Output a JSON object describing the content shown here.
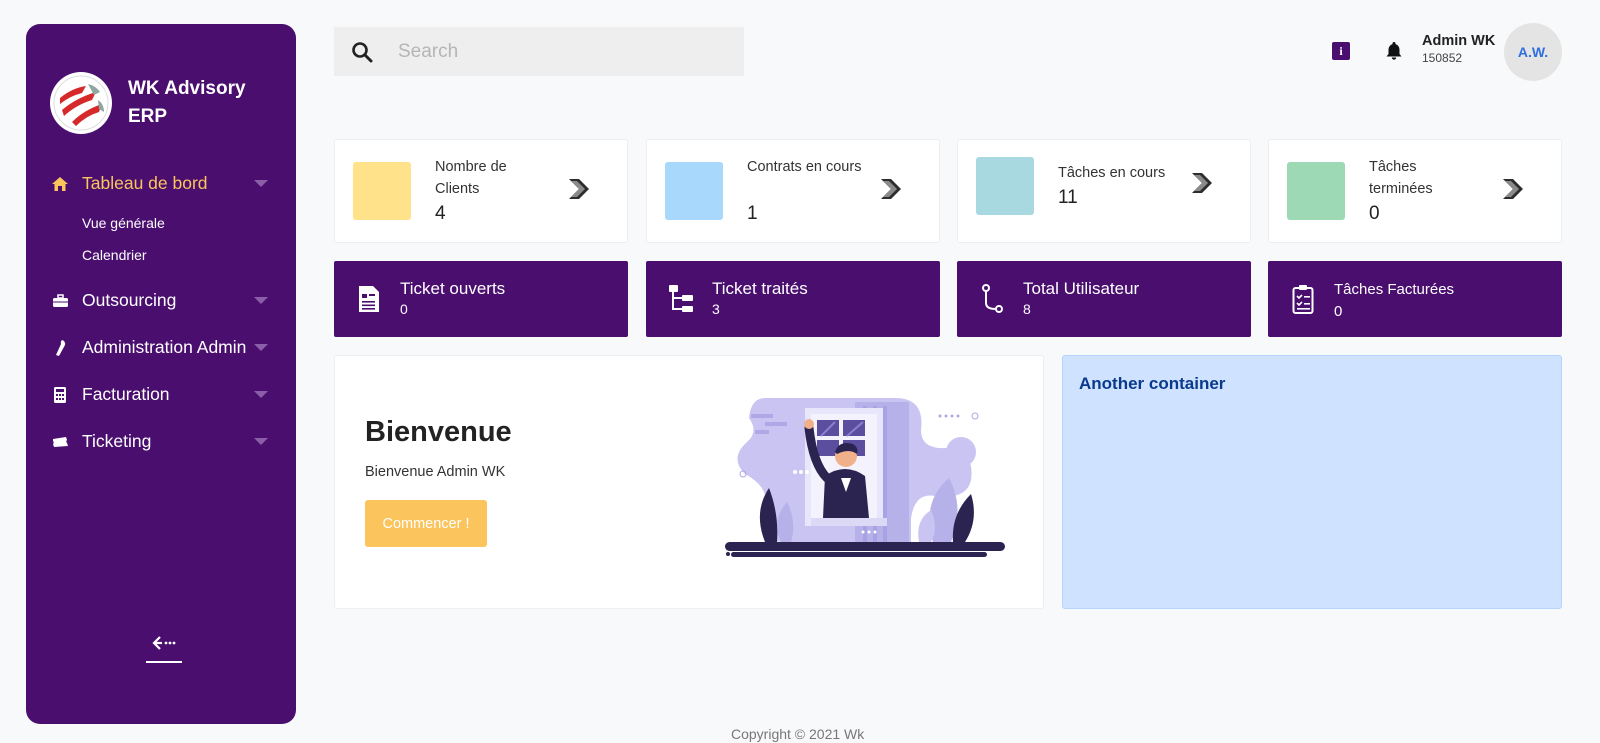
{
  "brand": {
    "name": "WK Advisory ERP"
  },
  "sidebar": {
    "items": [
      {
        "label": "Tableau de bord",
        "icon": "home-icon",
        "active": true,
        "children": [
          {
            "label": "Vue générale"
          },
          {
            "label": "Calendrier"
          }
        ]
      },
      {
        "label": "Outsourcing",
        "icon": "briefcase-icon"
      },
      {
        "label": "Administration Admin",
        "icon": "wrench-icon"
      },
      {
        "label": "Facturation",
        "icon": "calculator-icon"
      },
      {
        "label": "Ticketing",
        "icon": "ticket-icon"
      }
    ],
    "collapse_icon": "collapse-arrow-icon"
  },
  "search": {
    "placeholder": "Search"
  },
  "user": {
    "name": "Admin WK",
    "id": "150852",
    "initials": "A.W."
  },
  "stats": [
    {
      "label": "Nombre de Clients",
      "value": "4",
      "color": "#ffe289"
    },
    {
      "label": "Contrats en cours",
      "value": "1",
      "color": "#a8d8fb"
    },
    {
      "label": "Tâches en cours",
      "value": "11",
      "color": "#a8d8e0"
    },
    {
      "label": "Tâches terminées",
      "value": "0",
      "color": "#9dd9b4"
    }
  ],
  "tickets": [
    {
      "label": "Ticket ouverts",
      "value": "0",
      "icon": "document-icon"
    },
    {
      "label": "Ticket traités",
      "value": "3",
      "icon": "sitemap-icon"
    },
    {
      "label": "Total Utilisateur",
      "value": "8",
      "icon": "branch-icon"
    },
    {
      "label": "Tâches Facturées",
      "value": "0",
      "icon": "clipboard-check-icon"
    }
  ],
  "welcome": {
    "title": "Bienvenue",
    "text": "Bienvenue Admin WK",
    "button": "Commencer !"
  },
  "another": {
    "title": "Another container"
  },
  "footer": {
    "text": "Copyright © 2021 Wk"
  },
  "colors": {
    "primary": "#4a0e6f",
    "accent": "#fbc45c",
    "background": "#f8f9fb"
  }
}
